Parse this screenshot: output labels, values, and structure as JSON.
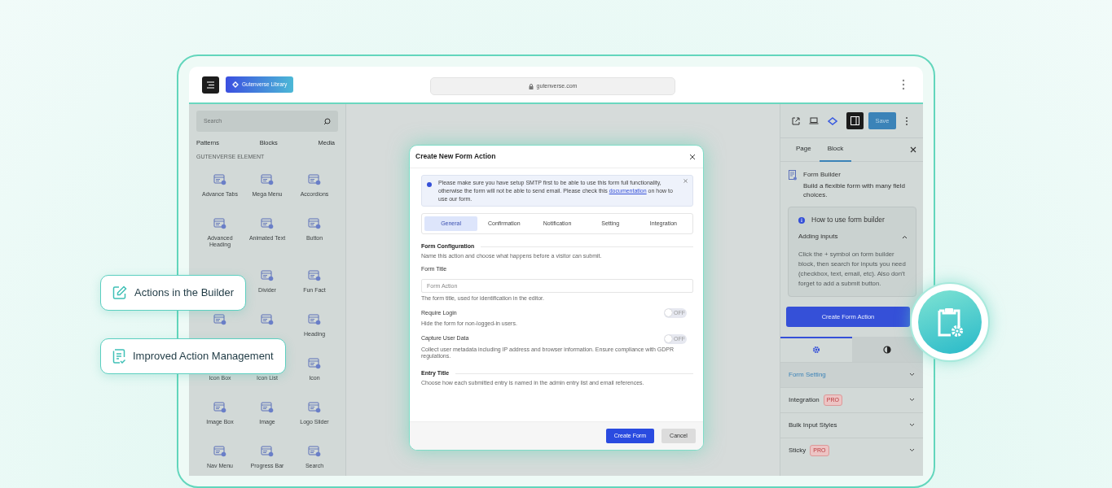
{
  "callouts": [
    {
      "kind": "edit",
      "label": "Actions in the Builder"
    },
    {
      "kind": "list",
      "label": "Improved Action Management"
    }
  ],
  "browser": {
    "brand": "Gutenverse Library",
    "url": "gutenverse.com"
  },
  "inserter": {
    "search": {
      "placeholder": "Search"
    },
    "tabs": [
      "Patterns",
      "Blocks",
      "Media"
    ],
    "section": "GUTENVERSE ELEMENT",
    "blocks": [
      {
        "icon": true,
        "label": "Advance Tabs"
      },
      {
        "icon": true,
        "label": "Mega Menu"
      },
      {
        "icon": true,
        "label": "Accordions"
      },
      {
        "icon": true,
        "label": "Advanced Heading"
      },
      {
        "icon": true,
        "label": "Animated Text"
      },
      {
        "icon": true,
        "label": "Button"
      },
      {
        "icon": false
      },
      {
        "icon": true,
        "label": "Divider"
      },
      {
        "icon": true,
        "label": "Fun Fact"
      },
      {
        "icon": true
      },
      {
        "icon": true
      },
      {
        "icon": true,
        "label": "Heading"
      },
      {
        "icon": false,
        "label": "Icon Box"
      },
      {
        "icon": false,
        "label": "Icon List"
      },
      {
        "icon": true,
        "label": "Icon"
      },
      {
        "icon": true,
        "label": "Image Box"
      },
      {
        "icon": true,
        "label": "Image"
      },
      {
        "icon": true,
        "label": "Logo Slider"
      },
      {
        "icon": true,
        "label": "Nav Menu"
      },
      {
        "icon": true,
        "label": "Progress Bar"
      },
      {
        "icon": true,
        "label": "Search"
      }
    ]
  },
  "modal": {
    "title": "Create New Form Action",
    "notice": {
      "text_before": "Please make sure you have setup SMTP first to be able to use this form full functionality, otherwise the form will not be able to send email. Please check this",
      "link": "documentation",
      "text_after": "on how to use our form."
    },
    "tabs": [
      {
        "label": "General",
        "selected": true
      },
      {
        "label": "Confirmation",
        "selected": false
      },
      {
        "label": "Notification",
        "selected": false
      },
      {
        "label": "Setting",
        "selected": false
      },
      {
        "label": "Integration",
        "selected": false
      }
    ],
    "fields": [
      {
        "kind": "heading",
        "title": "Form Configuration",
        "description": "Name this action and choose what happens before a visitor can submit."
      },
      {
        "kind": "input",
        "label": "Form Title",
        "placeholder": "Form Action",
        "help": "The form title, used for identification in the editor."
      },
      {
        "kind": "toggle",
        "label": "Require Login",
        "on": false,
        "state_label": "OFF",
        "help": "Hide the form for non-logged-in users."
      },
      {
        "kind": "toggle",
        "label": "Capture User Data",
        "on": false,
        "state_label": "OFF",
        "help": "Collect user metadata including IP address and browser information. Ensure compliance with GDPR regulations."
      },
      {
        "kind": "heading",
        "title": "Entry Title",
        "description": "Choose how each submitted entry is named in the admin entry list and email references."
      }
    ],
    "buttons": [
      {
        "kind": "primary",
        "label": "Create Form"
      },
      {
        "kind": "secondary",
        "label": "Cancel"
      }
    ]
  },
  "sidebar": {
    "save": "Save",
    "tabs": [
      {
        "label": "Page",
        "selected": false
      },
      {
        "label": "Block",
        "selected": true
      }
    ],
    "block": {
      "title": "Form Builder",
      "description": "Build a flexible form with many field choices."
    },
    "help": {
      "title": "How to use form builder",
      "section": "Adding inputs",
      "expanded": true,
      "text": "Click the + symbol on form builder block, then search for inputs you need (checkbox, text, email, etc). Also don't forget to add a submit button."
    },
    "action_button": "Create Form Action",
    "panel_tabs": [
      {
        "kind": "settings",
        "selected": true
      },
      {
        "kind": "style",
        "selected": false
      }
    ],
    "panels": [
      {
        "label": "Form Setting",
        "selected": true
      },
      {
        "label": "Integration",
        "selected": false,
        "badge": "PRO"
      },
      {
        "label": "Bulk Input Styles",
        "selected": false
      },
      {
        "label": "Sticky",
        "selected": false,
        "badge": "PRO"
      }
    ]
  }
}
